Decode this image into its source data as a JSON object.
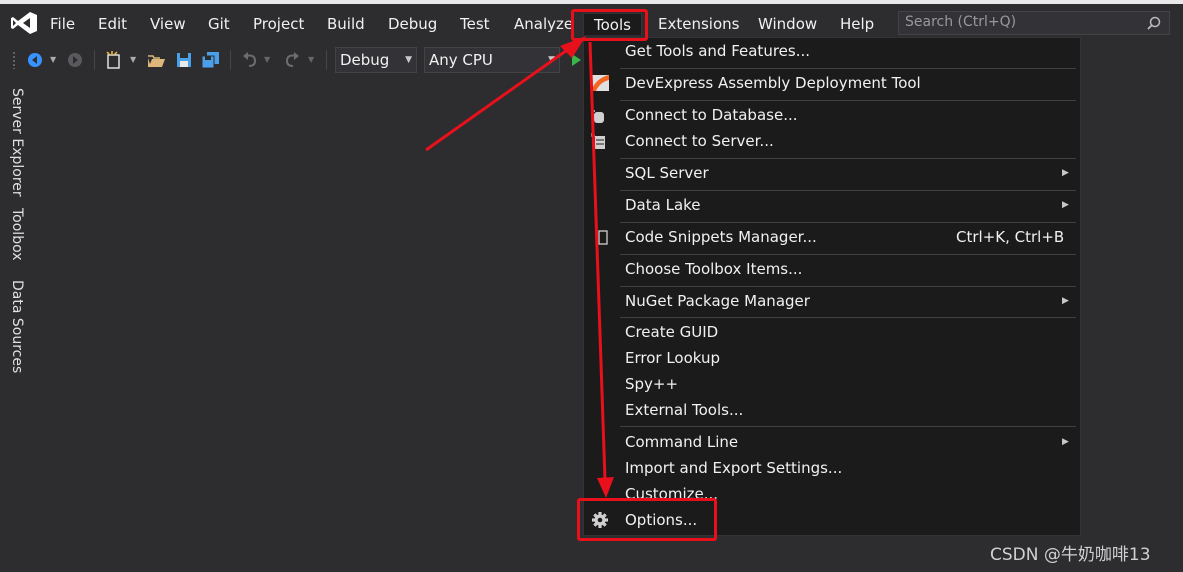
{
  "menubar": {
    "items": [
      "File",
      "Edit",
      "View",
      "Git",
      "Project",
      "Build",
      "Debug",
      "Test",
      "Analyze",
      "Tools",
      "Extensions",
      "Window",
      "Help"
    ],
    "search_placeholder": "Search (Ctrl+Q)"
  },
  "toolbar": {
    "config": "Debug",
    "platform": "Any CPU"
  },
  "side_tabs": [
    "Server Explorer",
    "Toolbox",
    "Data Sources"
  ],
  "tools_menu": {
    "items": [
      {
        "label": "Get Tools and Features...",
        "icon": "none"
      },
      {
        "label": "DevExpress Assembly Deployment Tool",
        "icon": "devexpress-icon"
      },
      {
        "label": "Connect to Database...",
        "icon": "database-connect-icon"
      },
      {
        "label": "Connect to Server...",
        "icon": "server-connect-icon"
      },
      {
        "label": "SQL Server",
        "submenu": true
      },
      {
        "label": "Data Lake",
        "submenu": true
      },
      {
        "label": "Code Snippets Manager...",
        "shortcut": "Ctrl+K, Ctrl+B",
        "icon": "snippet-icon"
      },
      {
        "label": "Choose Toolbox Items..."
      },
      {
        "label": "NuGet Package Manager",
        "submenu": true
      },
      {
        "label": "Create GUID"
      },
      {
        "label": "Error Lookup"
      },
      {
        "label": "Spy++"
      },
      {
        "label": "External Tools..."
      },
      {
        "label": "Command Line",
        "submenu": true
      },
      {
        "label": "Import and Export Settings..."
      },
      {
        "label": "Customize..."
      },
      {
        "label": "Options...",
        "icon": "gear-icon"
      }
    ]
  },
  "watermark": "CSDN @牛奶咖啡13",
  "colors": {
    "background": "#2d2d30",
    "menu_background": "#1b1b1c",
    "annotation_red": "#e8101a",
    "vs_purple": "#ffffff"
  }
}
